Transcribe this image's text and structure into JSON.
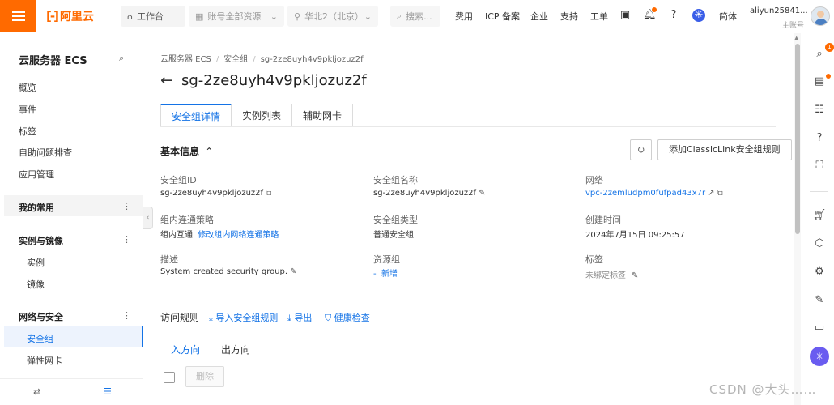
{
  "topbar": {
    "brand": "阿里云",
    "workbench": "工作台",
    "account_scope": "账号全部资源",
    "region": "华北2（北京）",
    "search_placeholder": "搜索...",
    "links": [
      "费用",
      "ICP 备案",
      "企业",
      "支持",
      "工单"
    ],
    "language": "简体",
    "username": "aliyun25841...",
    "user_role": "主账号"
  },
  "sidebar": {
    "title": "云服务器 ECS",
    "items": [
      "概览",
      "事件",
      "标签",
      "自助问题排查",
      "应用管理"
    ],
    "groups": [
      {
        "label": "我的常用"
      },
      {
        "label": "实例与镜像",
        "children": [
          "实例",
          "镜像"
        ]
      },
      {
        "label": "网络与安全",
        "children": [
          "安全组",
          "弹性网卡"
        ]
      }
    ]
  },
  "breadcrumb": [
    "云服务器 ECS",
    "安全组",
    "sg-2ze8uyh4v9pkljozuz2f"
  ],
  "page": {
    "title": "sg-2ze8uyh4v9pkljozuz2f",
    "tabs": [
      "安全组详情",
      "实例列表",
      "辅助网卡"
    ],
    "active_tab": "安全组详情"
  },
  "basic_info": {
    "section_title": "基本信息",
    "add_rule_button": "添加ClassicLink安全组规则",
    "fields": {
      "sg_id": {
        "label": "安全组ID",
        "value": "sg-2ze8uyh4v9pkljozuz2f"
      },
      "sg_name": {
        "label": "安全组名称",
        "value": "sg-2ze8uyh4v9pkljozuz2f"
      },
      "network": {
        "label": "网络",
        "value": "vpc-2zemludpm0fufpad43x7r"
      },
      "intra_policy": {
        "label": "组内连通策略",
        "value": "组内互通",
        "action": "修改组内网络连通策略"
      },
      "sg_type": {
        "label": "安全组类型",
        "value": "普通安全组"
      },
      "created": {
        "label": "创建时间",
        "value": "2024年7月15日 09:25:57"
      },
      "description": {
        "label": "描述",
        "value": "System created security group."
      },
      "resource_group": {
        "label": "资源组",
        "value": "-",
        "action": "新增"
      },
      "tags": {
        "label": "标签",
        "value": "未绑定标签"
      }
    }
  },
  "access_rules": {
    "title": "访问规则",
    "actions": [
      "导入安全组规则",
      "导出",
      "健康检查"
    ],
    "directions": [
      "入方向",
      "出方向"
    ],
    "active_direction": "入方向",
    "delete_button": "删除"
  },
  "watermark": "CSDN @大头……",
  "right_rail": {
    "badge_count": "1"
  },
  "colors": {
    "brand": "#ff6a00",
    "accent": "#1473e6"
  }
}
